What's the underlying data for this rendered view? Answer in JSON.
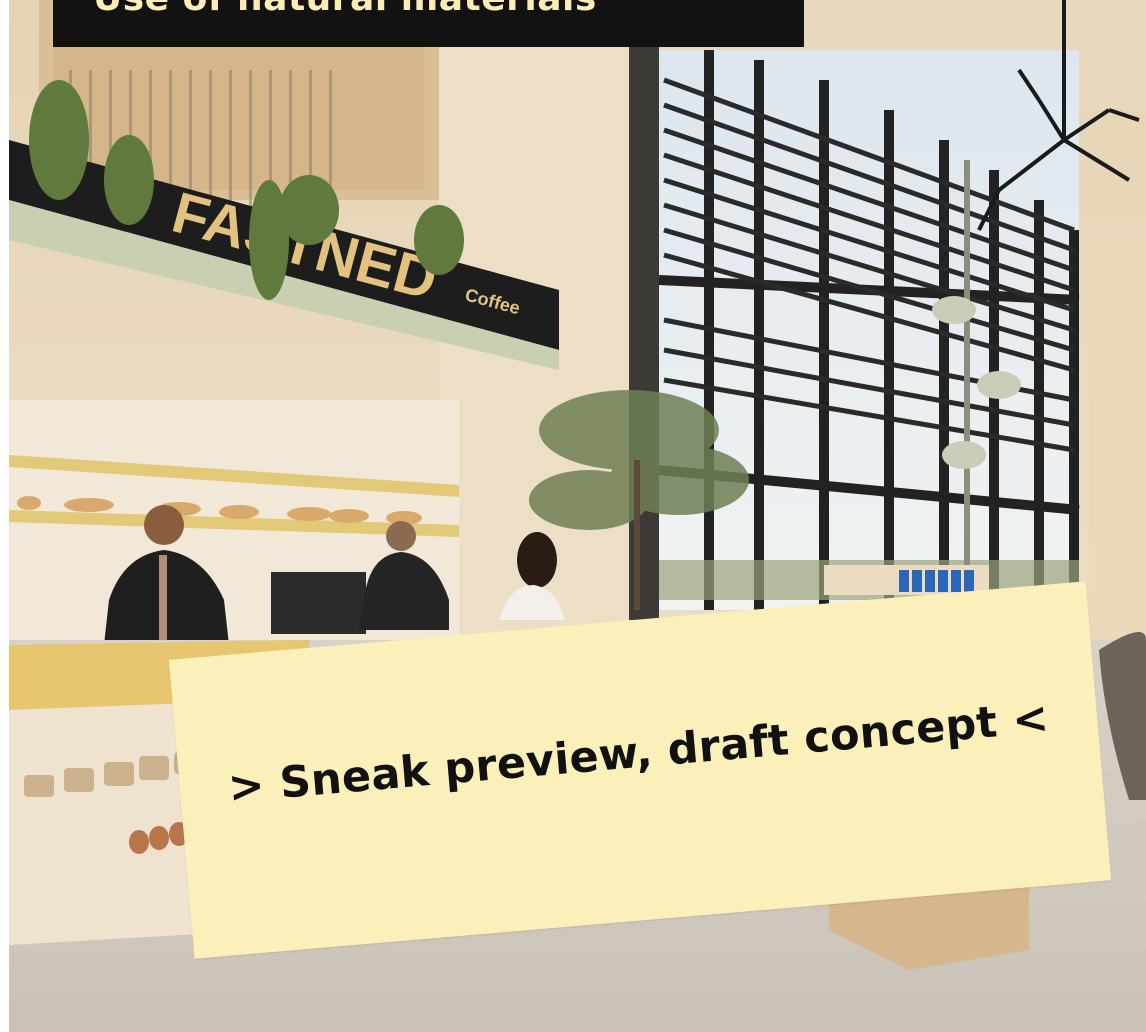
{
  "header": {
    "title": "Use of natural materials"
  },
  "photo": {
    "sign_brand": "FASTNED",
    "sign_sub": "Coffee"
  },
  "note": {
    "text": "> Sneak preview, draft concept <"
  },
  "colors": {
    "title_bg": "#121212",
    "title_text": "#fbedb5",
    "note_bg": "#fbf0ba",
    "note_text": "#111111"
  }
}
